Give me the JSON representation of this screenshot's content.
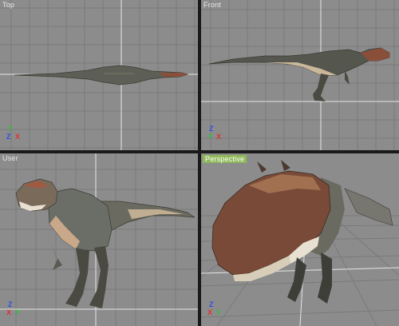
{
  "viewports": {
    "top": {
      "label": "Top",
      "axes": {
        "up": "Y",
        "left": "Z",
        "right": "X"
      }
    },
    "front": {
      "label": "Front",
      "axes": {
        "up": "Z",
        "left": "Y",
        "right": "X"
      }
    },
    "user": {
      "label": "User",
      "axes": {
        "up": "Z",
        "left": "X",
        "right": "Y"
      }
    },
    "perspective": {
      "label": "Perspective",
      "axes": {
        "up": "Z",
        "left": "X",
        "right": "Y"
      }
    }
  },
  "colors": {
    "viewport_bg": "#8c8c8c",
    "grid_line": "#7a7a7a",
    "grid_axis": "#e6e6e6",
    "axis_x": "#e03030",
    "axis_y": "#30c040",
    "axis_z": "#3050e0",
    "active_border": "#f2f2f2",
    "perspective_label_bg": "#8fb85a"
  }
}
